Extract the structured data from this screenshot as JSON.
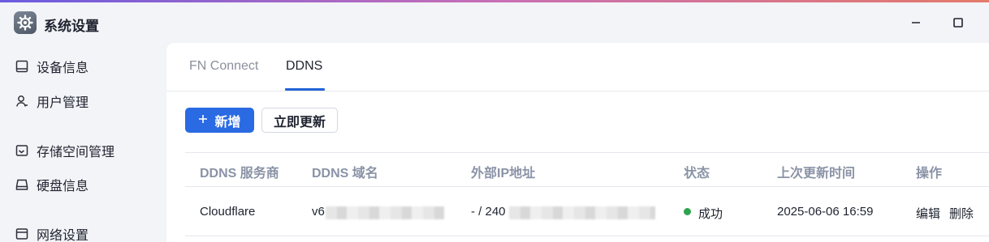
{
  "window": {
    "title": "系统设置",
    "minimize_icon": "minimize-icon",
    "maximize_icon": "maximize-icon"
  },
  "sidebar": {
    "items": [
      {
        "label": "设备信息",
        "icon": "monitor-icon"
      },
      {
        "label": "用户管理",
        "icon": "user-icon"
      },
      {
        "label": "存储空间管理",
        "icon": "storage-icon"
      },
      {
        "label": "硬盘信息",
        "icon": "harddisk-icon"
      },
      {
        "label": "网络设置",
        "icon": "network-icon"
      }
    ]
  },
  "tabs": [
    {
      "label": "FN Connect",
      "active": false
    },
    {
      "label": "DDNS",
      "active": true
    }
  ],
  "toolbar": {
    "add_label": "新增",
    "add_icon": "plus-icon",
    "refresh_label": "立即更新"
  },
  "table": {
    "columns": [
      "DDNS 服务商",
      "DDNS 域名",
      "外部IP地址",
      "状态",
      "上次更新时间",
      "操作"
    ],
    "rows": [
      {
        "provider": "Cloudflare",
        "domain_prefix": "v6",
        "ip_prefix": "- / 240",
        "status": "成功",
        "status_color": "#2ea44f",
        "updated": "2025-06-06 16:59",
        "actions": [
          "编辑",
          "删除"
        ]
      }
    ]
  },
  "colors": {
    "accent": "#2a6ae3",
    "success": "#2ea44f"
  }
}
